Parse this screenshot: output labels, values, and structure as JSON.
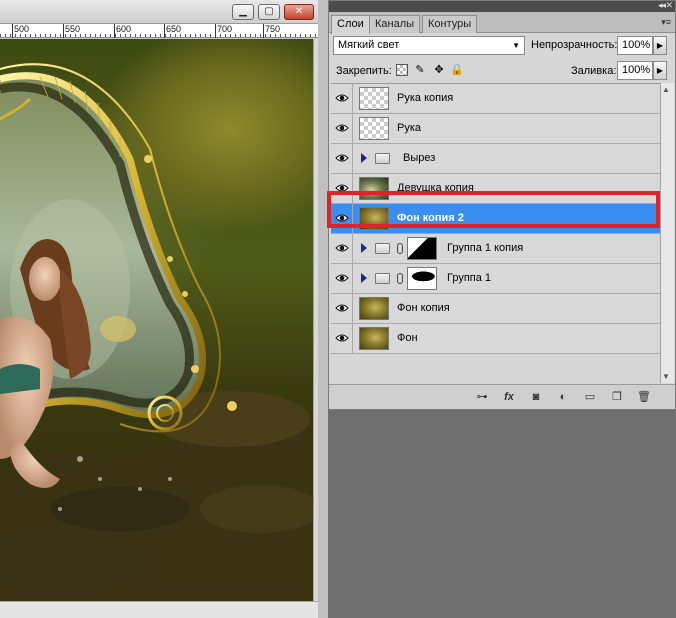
{
  "document": {
    "window_buttons": {
      "minimize": "▁",
      "maximize": "▢",
      "close": "✕"
    },
    "ruler_labels": [
      "500",
      "550",
      "600",
      "650",
      "700",
      "750"
    ]
  },
  "panel": {
    "collapse_glyph": "◂◂",
    "close_glyph": "✕",
    "menu_glyph": "▾≡",
    "tabs": [
      {
        "label": "Слои",
        "active": true
      },
      {
        "label": "Каналы",
        "active": false
      },
      {
        "label": "Контуры",
        "active": false
      }
    ],
    "blend_mode": "Мягкий свет",
    "opacity_label": "Непрозрачность:",
    "opacity_value": "100%",
    "lock_label": "Закрепить:",
    "fill_label": "Заливка:",
    "fill_value": "100%",
    "layers": [
      {
        "name": "Рука копия",
        "thumb": "transparent",
        "type": "layer",
        "selected": false
      },
      {
        "name": "Рука",
        "thumb": "transparent",
        "type": "layer",
        "selected": false
      },
      {
        "name": "Вырез",
        "thumb": "",
        "type": "group",
        "selected": false
      },
      {
        "name": "Девушка копия",
        "thumb": "girl",
        "type": "layer",
        "selected": false
      },
      {
        "name": "Фон копия 2",
        "thumb": "bg",
        "type": "layer",
        "selected": true
      },
      {
        "name": "Группа 1 копия",
        "thumb": "mask1",
        "type": "group-mask",
        "selected": false
      },
      {
        "name": "Группа 1",
        "thumb": "mask2",
        "type": "group-mask",
        "selected": false
      },
      {
        "name": "Фон копия",
        "thumb": "bg",
        "type": "layer",
        "selected": false
      },
      {
        "name": "Фон",
        "thumb": "bg",
        "type": "layer",
        "selected": false
      }
    ],
    "scroll_up": "▲",
    "scroll_down": "▼",
    "footer_icons": [
      "link-layers-icon",
      "fx-icon",
      "mask-icon",
      "adjustment-icon",
      "new-group-icon",
      "new-layer-icon",
      "trash-icon"
    ],
    "footer_glyphs": [
      "⊶",
      "fx",
      "◙",
      "◐",
      "▭",
      "❐",
      "🗑"
    ]
  },
  "colors": {
    "selection_blue": "#3a8ef0",
    "highlight_red": "#e3212b"
  }
}
